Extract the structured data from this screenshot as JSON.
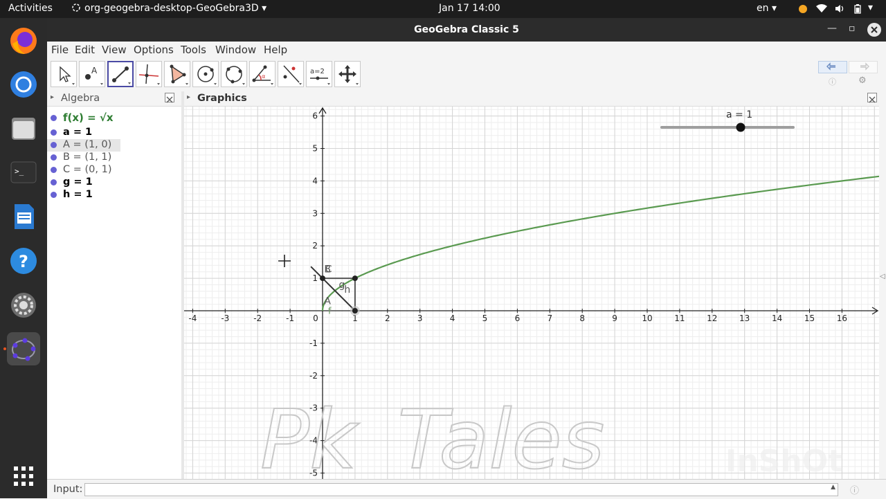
{
  "system": {
    "activities": "Activities",
    "app_name": "org-geogebra-desktop-GeoGebra3D",
    "datetime": "Jan 17  14:00",
    "language": "en",
    "notification_color": "#f5a623"
  },
  "window": {
    "title": "GeoGebra Classic 5"
  },
  "menu": {
    "items": [
      "File",
      "Edit",
      "View",
      "Options",
      "Tools",
      "Window",
      "Help"
    ]
  },
  "toolbar": {
    "tools": [
      "move-tool",
      "point-tool",
      "segment-tool",
      "perpendicular-line-tool",
      "polygon-tool",
      "circle-center-tool",
      "circle-three-points-tool",
      "angle-tool",
      "reflect-tool",
      "slider-tool",
      "move-graphics-tool"
    ],
    "selected": "segment-tool",
    "slider_tool_label": "a=2"
  },
  "algebra": {
    "title": "Algebra",
    "rows": [
      {
        "text": "f(x) = √x",
        "color": "#2e7d32"
      },
      {
        "text": "a = 1",
        "color": "#000000"
      },
      {
        "text": "A = (1, 0)",
        "color": "#555555",
        "selected": true
      },
      {
        "text": "B = (1, 1)",
        "color": "#555555"
      },
      {
        "text": "C = (0, 1)",
        "color": "#555555"
      },
      {
        "text": "g = 1",
        "color": "#000000"
      },
      {
        "text": "h = 1",
        "color": "#000000"
      }
    ],
    "dot_color": "#6661d3"
  },
  "graphics": {
    "title": "Graphics",
    "slider": {
      "label": "a = 1",
      "value": 1,
      "min": -5,
      "max": 5
    },
    "x_ticks": [
      "-4",
      "-3",
      "-2",
      "-1",
      "0",
      "1",
      "2",
      "3",
      "4",
      "5",
      "6",
      "7",
      "8",
      "9",
      "10",
      "11",
      "12",
      "13",
      "14",
      "15",
      "16"
    ],
    "y_ticks": [
      "6",
      "5",
      "4",
      "3",
      "2",
      "1",
      "-1",
      "-2",
      "-3",
      "-4",
      "-5"
    ],
    "points": [
      {
        "name": "A",
        "x": 1,
        "y": 0
      },
      {
        "name": "B",
        "x": 1,
        "y": 1
      },
      {
        "name": "C",
        "x": 0,
        "y": 1
      }
    ],
    "labels": {
      "f": "f",
      "g": "g",
      "h": "h"
    },
    "curve_color": "#5a9a50",
    "watermark": "Pk_Tales",
    "corner_watermark": "InShOt"
  },
  "input": {
    "label": "Input:"
  }
}
